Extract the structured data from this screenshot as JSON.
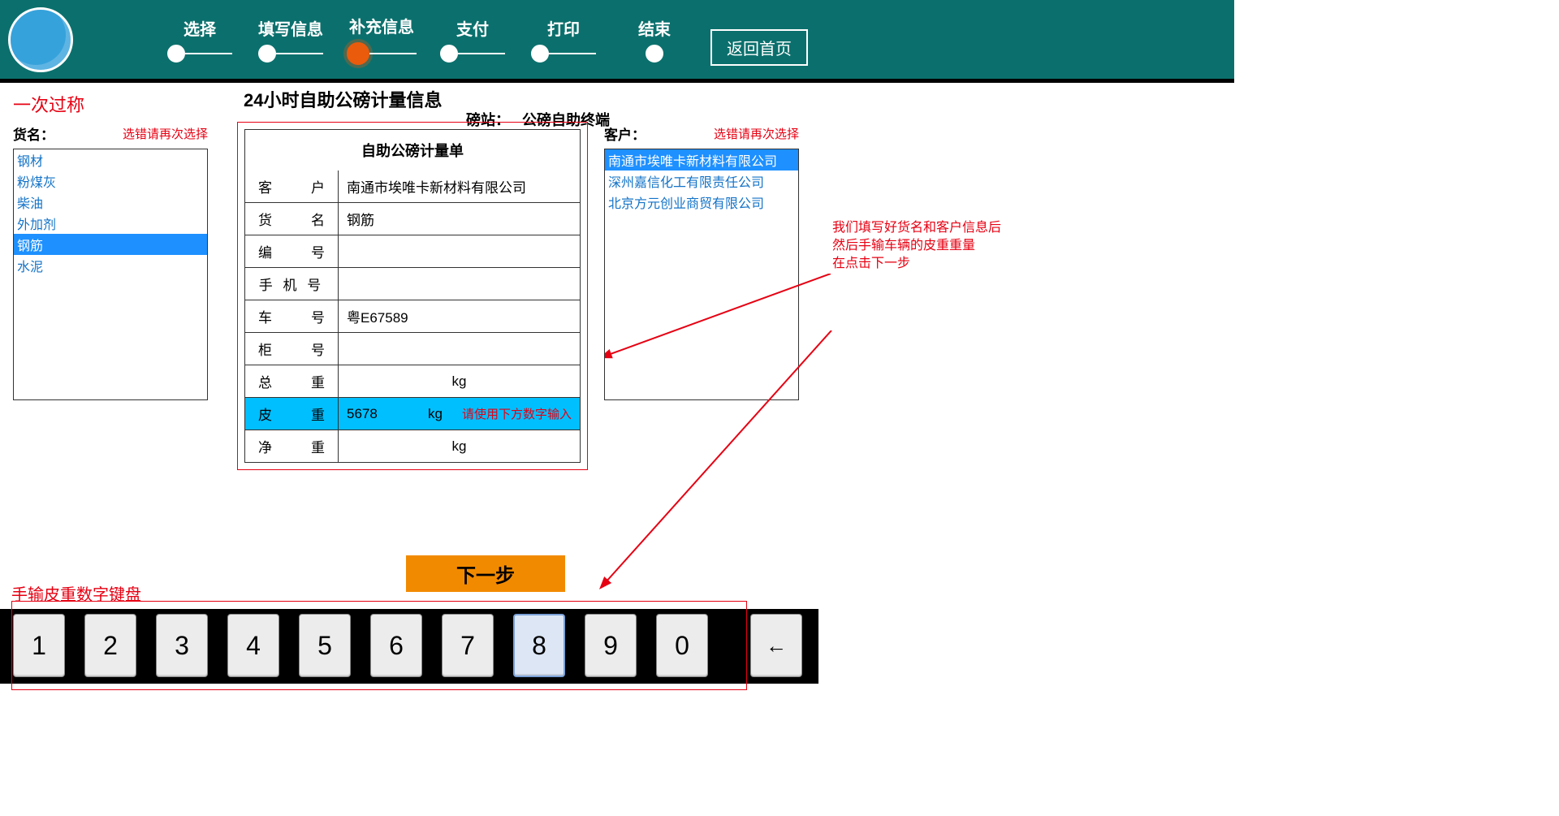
{
  "header": {
    "steps": [
      "选择",
      "填写信息",
      "补充信息",
      "支付",
      "打印",
      "结束"
    ],
    "active_step_index": 2,
    "home_button": "返回首页"
  },
  "subtitle": "一次过称",
  "main_title": "24小时自助公磅计量信息",
  "station": {
    "prefix": "磅站：",
    "name": "公磅自助终端"
  },
  "goods": {
    "label": "货名：",
    "hint": "选错请再次选择",
    "items": [
      "钢材",
      "粉煤灰",
      "柴油",
      "外加剂",
      "钢筋",
      "水泥"
    ],
    "selected_index": 4
  },
  "form": {
    "title": "自助公磅计量单",
    "rows": {
      "customer": {
        "label_a": "客",
        "label_b": "户",
        "value": "南通市埃唯卡新材料有限公司"
      },
      "goods": {
        "label_a": "货",
        "label_b": "名",
        "value": "钢筋"
      },
      "serial": {
        "label_a": "编",
        "label_b": "号",
        "value": ""
      },
      "phone": {
        "label": "手 机 号",
        "value": ""
      },
      "plate": {
        "label_a": "车",
        "label_b": "号",
        "value": "粤E67589"
      },
      "container": {
        "label_a": "柜",
        "label_b": "号",
        "value": ""
      },
      "gross": {
        "label_a": "总",
        "label_b": "重",
        "value": "",
        "unit": "kg"
      },
      "tare": {
        "label_a": "皮",
        "label_b": "重",
        "value": "5678",
        "unit": "kg",
        "hint": "请使用下方数字输入"
      },
      "net": {
        "label_a": "净",
        "label_b": "重",
        "value": "",
        "unit": "kg"
      }
    },
    "next_button": "下一步"
  },
  "customers": {
    "label": "客户：",
    "hint": "选错请再次选择",
    "items": [
      "南通市埃唯卡新材料有限公司",
      "深州嘉信化工有限责任公司",
      "北京方元创业商贸有限公司"
    ],
    "selected_index": 0
  },
  "annotation": {
    "line1": "我们填写好货名和客户信息后",
    "line2": "然后手输车辆的皮重重量",
    "line3": "在点击下一步"
  },
  "keyboard": {
    "title": "手输皮重数字键盘",
    "keys": [
      "1",
      "2",
      "3",
      "4",
      "5",
      "6",
      "7",
      "8",
      "9",
      "0"
    ],
    "active_key": "8",
    "backspace": "←"
  }
}
